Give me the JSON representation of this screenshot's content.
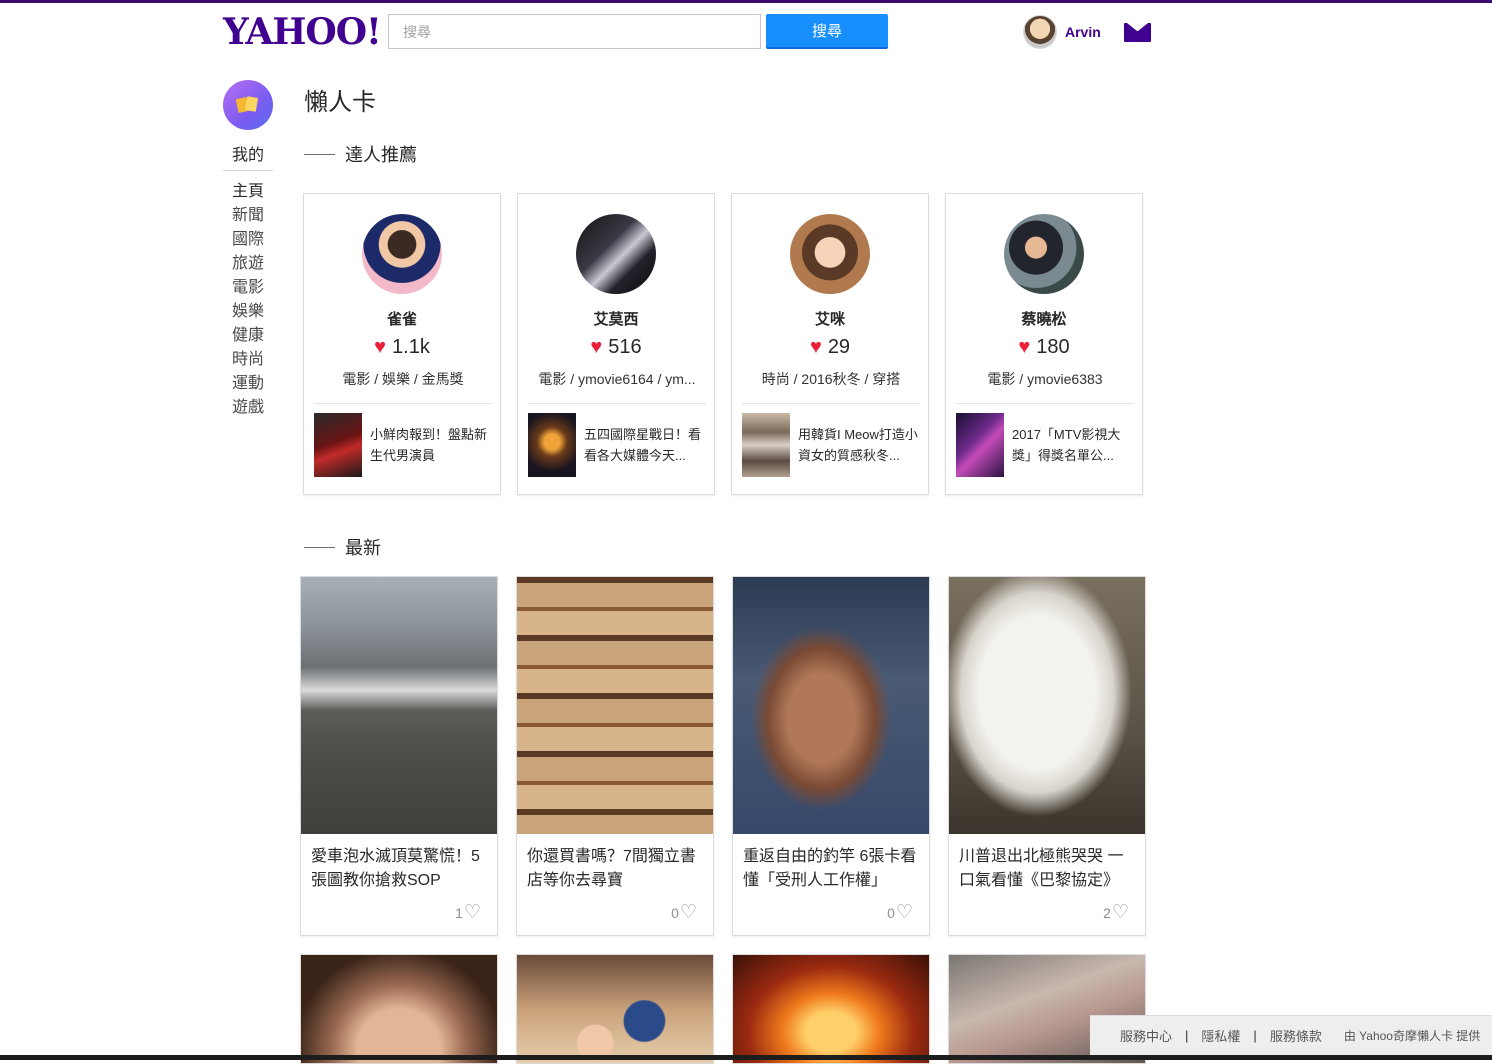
{
  "header": {
    "logo": "YAHOO!",
    "search_placeholder": "搜尋",
    "search_button": "搜尋",
    "user_name": "Arvin"
  },
  "sidebar": {
    "mine": "我的",
    "items": [
      "主頁",
      "新聞",
      "國際",
      "旅遊",
      "電影",
      "娛樂",
      "健康",
      "時尚",
      "運動",
      "遊戲"
    ]
  },
  "page": {
    "title": "懶人卡",
    "section_experts": "達人推薦",
    "section_latest": "最新"
  },
  "experts": [
    {
      "name": "雀雀",
      "likes": "1.1k",
      "tags": "電影 / 娛樂 / 金馬獎",
      "post": "小鮮肉報到！盤點新生代男演員"
    },
    {
      "name": "艾莫西",
      "likes": "516",
      "tags": "電影 / ymovie6164 / ym...",
      "post": "五四國際星戰日！看看各大媒體今天..."
    },
    {
      "name": "艾咪",
      "likes": "29",
      "tags": "時尚 / 2016秋冬 / 穿搭",
      "post": "用韓貨I Meow打造小資女的質感秋冬..."
    },
    {
      "name": "蔡曉松",
      "likes": "180",
      "tags": "電影 / ymovie6383",
      "post": "2017「MTV影視大獎」得獎名單公..."
    }
  ],
  "latest": [
    {
      "title": "愛車泡水滅頂莫驚慌！5張圖教你搶救SOP",
      "likes": "1"
    },
    {
      "title": "你還買書嗎？7間獨立書店等你去尋寶",
      "likes": "0"
    },
    {
      "title": "重返自由的釣竿 6張卡看懂「受刑人工作權」",
      "likes": "0"
    },
    {
      "title": "川普退出北極熊哭哭 一口氣看懂《巴黎協定》",
      "likes": "2"
    }
  ],
  "footer": {
    "help": "服務中心",
    "privacy": "隱私權",
    "terms": "服務條款",
    "provided_by": "由 Yahoo奇摩懶人卡 提供"
  },
  "colors": {
    "brand": "#400090",
    "search_button": "#188fff",
    "heart": "#e8203a"
  }
}
